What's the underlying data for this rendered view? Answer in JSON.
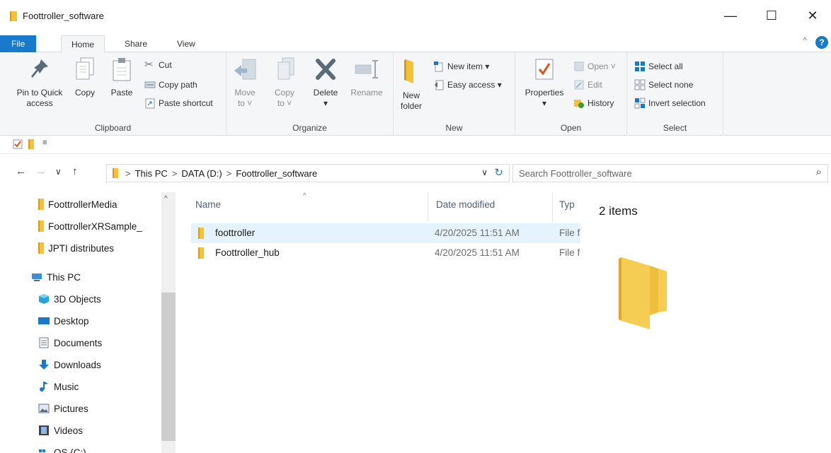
{
  "window": {
    "title": "Foottroller_software",
    "minimize_glyph": "—",
    "maximize_glyph": "☐",
    "close_glyph": "✕"
  },
  "tabs": {
    "file": "File",
    "home": "Home",
    "share": "Share",
    "view": "View",
    "collapse_glyph": "^",
    "help_glyph": "?"
  },
  "ribbon": {
    "clipboard": {
      "label": "Clipboard",
      "pin_line1": "Pin to Quick",
      "pin_line2": "access",
      "copy": "Copy",
      "paste": "Paste",
      "cut": "Cut",
      "copy_path": "Copy path",
      "paste_shortcut": "Paste shortcut"
    },
    "organize": {
      "label": "Organize",
      "move_line1": "Move",
      "move_line2": "to ˅",
      "copy_line1": "Copy",
      "copy_line2": "to ˅",
      "delete": "Delete",
      "delete_arrow": "▾",
      "rename": "Rename"
    },
    "new": {
      "label": "New",
      "new_folder_line1": "New",
      "new_folder_line2": "folder",
      "new_item": "New item ▾",
      "easy_access": "Easy access ▾"
    },
    "open": {
      "label": "Open",
      "properties": "Properties",
      "properties_arrow": "▾",
      "open": "Open ˅",
      "edit": "Edit",
      "history": "History"
    },
    "select": {
      "label": "Select",
      "select_all": "Select all",
      "select_none": "Select none",
      "invert_selection": "Invert selection"
    }
  },
  "qat": {
    "dropdown_glyph": "≡"
  },
  "address": {
    "back": "←",
    "forward": "→",
    "recent": "∨",
    "up": "↑",
    "sep": ">",
    "crumbs": [
      "This PC",
      "DATA (D:)",
      "Foottroller_software"
    ],
    "dropdown": "∨",
    "refresh": "↻",
    "search_placeholder": "Search Foottroller_software",
    "search_glyph": "⌕"
  },
  "nav": {
    "items": [
      {
        "label": "FoottrollerMedia",
        "icon": "folder-icon"
      },
      {
        "label": "FoottrollerXRSample_",
        "icon": "folder-icon"
      },
      {
        "label": "JPTI distributes",
        "icon": "folder-icon"
      },
      {
        "label": "This PC",
        "icon": "computer-icon"
      },
      {
        "label": "3D Objects",
        "icon": "cube-icon"
      },
      {
        "label": "Desktop",
        "icon": "desktop-icon"
      },
      {
        "label": "Documents",
        "icon": "documents-icon"
      },
      {
        "label": "Downloads",
        "icon": "download-icon"
      },
      {
        "label": "Music",
        "icon": "music-icon"
      },
      {
        "label": "Pictures",
        "icon": "pictures-icon"
      },
      {
        "label": "Videos",
        "icon": "videos-icon"
      },
      {
        "label": "OS (C:)",
        "icon": "drive-icon"
      }
    ],
    "scroll_up_glyph": "^"
  },
  "filelist": {
    "columns": {
      "name": "Name",
      "date": "Date modified",
      "type": "Typ"
    },
    "sort_caret": "^",
    "rows": [
      {
        "name": "foottroller",
        "date": "4/20/2025 11:51 AM",
        "type": "File folder",
        "selected": true
      },
      {
        "name": "Foottroller_hub",
        "date": "4/20/2025 11:51 AM",
        "type": "File folder",
        "selected": false
      }
    ]
  },
  "details": {
    "item_count": "2 items"
  },
  "colors": {
    "accent": "#1979ca",
    "folder": "#f3c13a",
    "selected_row": "#e5f3ff",
    "ribbon_bg": "#f5f6f7"
  }
}
